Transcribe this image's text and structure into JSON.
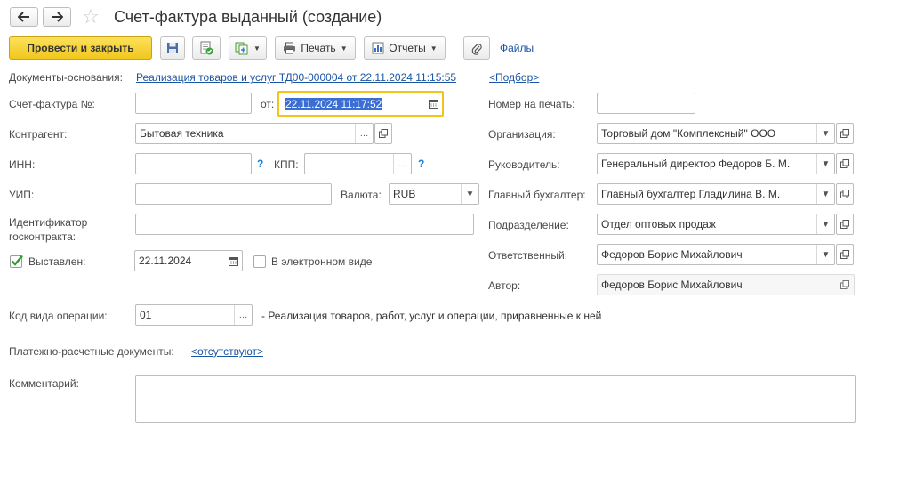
{
  "window": {
    "title": "Счет-фактура выданный (создание)"
  },
  "toolbar": {
    "post_close_label": "Провести и закрыть",
    "print_label": "Печать",
    "reports_label": "Отчеты",
    "files_label": "Файлы"
  },
  "basis": {
    "label": "Документы-основания:",
    "link": "Реализация товаров и услуг ТД00-000004 от 22.11.2024 11:15:55",
    "pick": "<Подбор>"
  },
  "invoice": {
    "number_label": "Счет-фактура №:",
    "number_value": "",
    "date_label": "от:",
    "date_value": "22.11.2024 11:17:52"
  },
  "counterparty": {
    "label": "Контрагент:",
    "value": "Бытовая техника"
  },
  "inn": {
    "label": "ИНН:",
    "value": "",
    "help": "?"
  },
  "kpp": {
    "label": "КПП:",
    "value": "",
    "help": "?"
  },
  "uip": {
    "label": "УИП:",
    "value": ""
  },
  "currency": {
    "label": "Валюта:",
    "value": "RUB"
  },
  "contract_id": {
    "label": "Идентификатор госконтракта:",
    "label_line1": "Идентификатор",
    "label_line2": "госконтракта:",
    "value": ""
  },
  "issued": {
    "label": "Выставлен:",
    "checked": true,
    "date": "22.11.2024"
  },
  "electronic": {
    "label": "В электронном виде",
    "checked": false
  },
  "operation": {
    "label": "Код вида операции:",
    "code": "01",
    "description": "- Реализация товаров, работ, услуг и операции, приравненные к ней"
  },
  "payment_docs": {
    "label": "Платежно-расчетные документы:",
    "link": "<отсутствуют>"
  },
  "comment": {
    "label": "Комментарий:",
    "value": ""
  },
  "right": {
    "print_number": {
      "label": "Номер на печать:",
      "value": ""
    },
    "organization": {
      "label": "Организация:",
      "value": "Торговый дом \"Комплексный\" ООО"
    },
    "head": {
      "label": "Руководитель:",
      "value": "Генеральный директор Федоров Б. М."
    },
    "accountant": {
      "label": "Главный бухгалтер:",
      "value": "Главный бухгалтер Гладилина В. М."
    },
    "department": {
      "label": "Подразделение:",
      "value": "Отдел оптовых продаж"
    },
    "responsible": {
      "label": "Ответственный:",
      "value": "Федоров Борис Михайлович"
    },
    "author": {
      "label": "Автор:",
      "value": "Федоров Борис Михайлович"
    }
  },
  "colors": {
    "primary_button": "#f5cf2a",
    "link": "#1a55a4",
    "focus_border": "#f0c419",
    "selection": "#3b6ed4"
  }
}
